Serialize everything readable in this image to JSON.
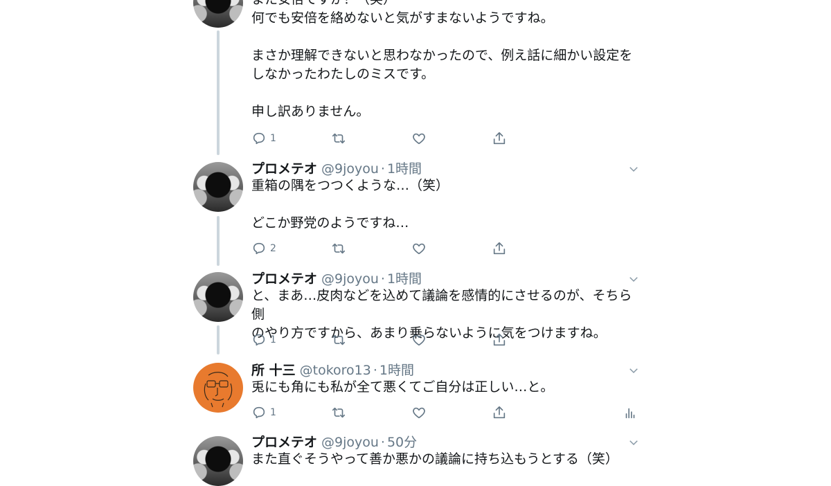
{
  "tweet0": {
    "text_partial": "また安倍ですか？（笑）",
    "text": "何でも安倍を絡めないと気がすまないようですね。\n\nまさか理解できないと思わなかったので、例え話に細かい設定を\nしなかったわたしのミスです。\n\n申し訳ありません。",
    "reply_count": "1"
  },
  "tweet1": {
    "name": "プロメテオ",
    "handle": "@9joyou",
    "sep": "·",
    "time": "1時間",
    "text": "重箱の隅をつつくような…（笑）\n\nどこか野党のようですね…",
    "reply_count": "2"
  },
  "tweet2": {
    "name": "プロメテオ",
    "handle": "@9joyou",
    "sep": "·",
    "time": "1時間",
    "text": "と、まあ…皮肉などを込めて議論を感情的にさせるのが、そちら側\nのやり方ですから、あまり乗らないように気をつけますね。",
    "reply_count": "1"
  },
  "tweet3": {
    "name": "所 十三",
    "handle": "@tokoro13",
    "sep": "·",
    "time": "1時間",
    "text": "兎にも角にも私が全て悪くてご自分は正しい…と。",
    "reply_count": "1"
  },
  "tweet4": {
    "name": "プロメテオ",
    "handle": "@9joyou",
    "sep": "·",
    "time": "50分",
    "text": "また直ぐそうやって善か悪かの議論に持ち込もうとする（笑）"
  },
  "icons": {
    "reply": "reply-icon",
    "retweet": "retweet-icon",
    "like": "like-icon",
    "share": "share-icon",
    "analytics": "analytics-icon",
    "menu": "chevron-down-icon"
  },
  "colors": {
    "text": "#14171a",
    "secondary": "#657786",
    "thread_line": "#ccd6dd"
  }
}
